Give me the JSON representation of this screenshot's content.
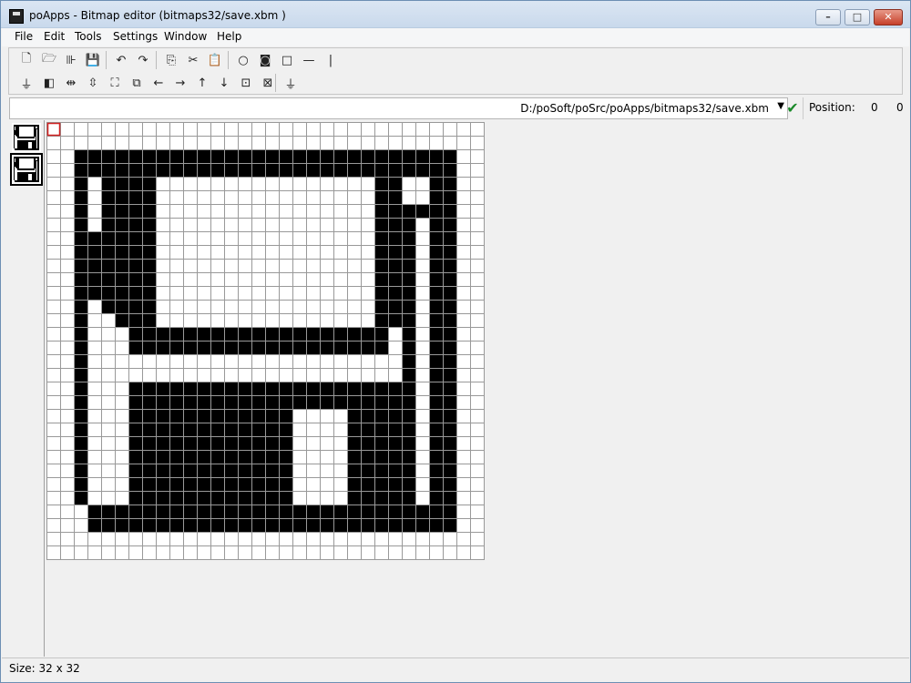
{
  "window": {
    "title": "poApps - Bitmap editor (bitmaps32/save.xbm )",
    "controls": {
      "minimize": "–",
      "maximize": "□",
      "close": "✕"
    }
  },
  "menu": [
    {
      "label": "File"
    },
    {
      "label": "Edit"
    },
    {
      "label": "Tools"
    },
    {
      "label": "Settings"
    },
    {
      "label": "Window"
    },
    {
      "label": "Help"
    }
  ],
  "toolbar": {
    "row1": [
      {
        "name": "new-file-icon",
        "glyph": "🗋"
      },
      {
        "name": "open-folder-icon",
        "glyph": "🗁"
      },
      {
        "name": "browse-icon",
        "glyph": "⊪"
      },
      {
        "name": "save-icon",
        "glyph": "💾"
      },
      {
        "name": "undo-icon",
        "glyph": "↶"
      },
      {
        "name": "redo-icon",
        "glyph": "↷"
      },
      {
        "name": "copy-icon",
        "glyph": "⎘"
      },
      {
        "name": "cut-icon",
        "glyph": "✂"
      },
      {
        "name": "paste-icon",
        "glyph": "📋"
      },
      {
        "name": "circle-tool-icon",
        "glyph": "○"
      },
      {
        "name": "filled-rect-tool-icon",
        "glyph": "◙"
      },
      {
        "name": "rect-tool-icon",
        "glyph": "□"
      },
      {
        "name": "hline-tool-icon",
        "glyph": "—"
      },
      {
        "name": "vline-tool-icon",
        "glyph": "|"
      }
    ],
    "row2": [
      {
        "name": "clear-icon",
        "glyph": "⏚"
      },
      {
        "name": "invert-icon",
        "glyph": "◧"
      },
      {
        "name": "flip-horizontal-icon",
        "glyph": "⇹"
      },
      {
        "name": "flip-vertical-icon",
        "glyph": "⇳"
      },
      {
        "name": "crop-icon",
        "glyph": "⛶"
      },
      {
        "name": "resize-icon",
        "glyph": "⧉"
      },
      {
        "name": "shift-left-icon",
        "glyph": "←"
      },
      {
        "name": "shift-right-icon",
        "glyph": "→"
      },
      {
        "name": "shift-up-icon",
        "glyph": "↑"
      },
      {
        "name": "shift-down-icon",
        "glyph": "↓"
      },
      {
        "name": "zoom-fit-icon",
        "glyph": "⊡"
      },
      {
        "name": "zoom-cross-icon",
        "glyph": "⊠"
      },
      {
        "name": "apply-icon",
        "glyph": "⏚"
      }
    ]
  },
  "path": {
    "value": "D:/poSoft/poSrc/poApps/bitmaps32/save.xbm"
  },
  "position": {
    "label": "Position:",
    "x": "0",
    "y": "0"
  },
  "status": {
    "size": "Size: 32 x 32"
  },
  "bitmap": {
    "width": 32,
    "height": 32,
    "rows": [
      "00000000000000000000000000000000",
      "00000000000000000000000000000000",
      "00111111111111111111111111111100",
      "00111111111111111111111111111100",
      "00101111000000000000000011001100",
      "00101111000000000000000011001100",
      "00101111000000000000000011111100",
      "00101111000000000000000011101100",
      "00111111000000000000000011101100",
      "00111111000000000000000011101100",
      "00111111000000000000000011101100",
      "00111111000000000000000011101100",
      "00111111000000000000000011101100",
      "00101111000000000000000011101100",
      "00100111000000000000000011101100",
      "00100011111111111111111110101100",
      "00100011111111111111111110101100",
      "00100000000000000000000000101100",
      "00100000000000000000000000101100",
      "00100011111111111111111111101100",
      "00100011111111111111111111101100",
      "00100011111111111100001111101100",
      "00100011111111111100001111101100",
      "00100011111111111100001111101100",
      "00100011111111111100001111101100",
      "00100011111111111100001111101100",
      "00100011111111111100001111101100",
      "00100011111111111100001111101100",
      "00011111111111111111111111111100",
      "00011111111111111111111111111100",
      "00000000000000000000000000000000",
      "00000000000000000000000000000000"
    ],
    "cursor_cell": [
      0,
      0
    ],
    "colors": {
      "on": "#000000",
      "off": "#ffffff",
      "grid": "#999999",
      "cursor": "#d02020"
    }
  }
}
